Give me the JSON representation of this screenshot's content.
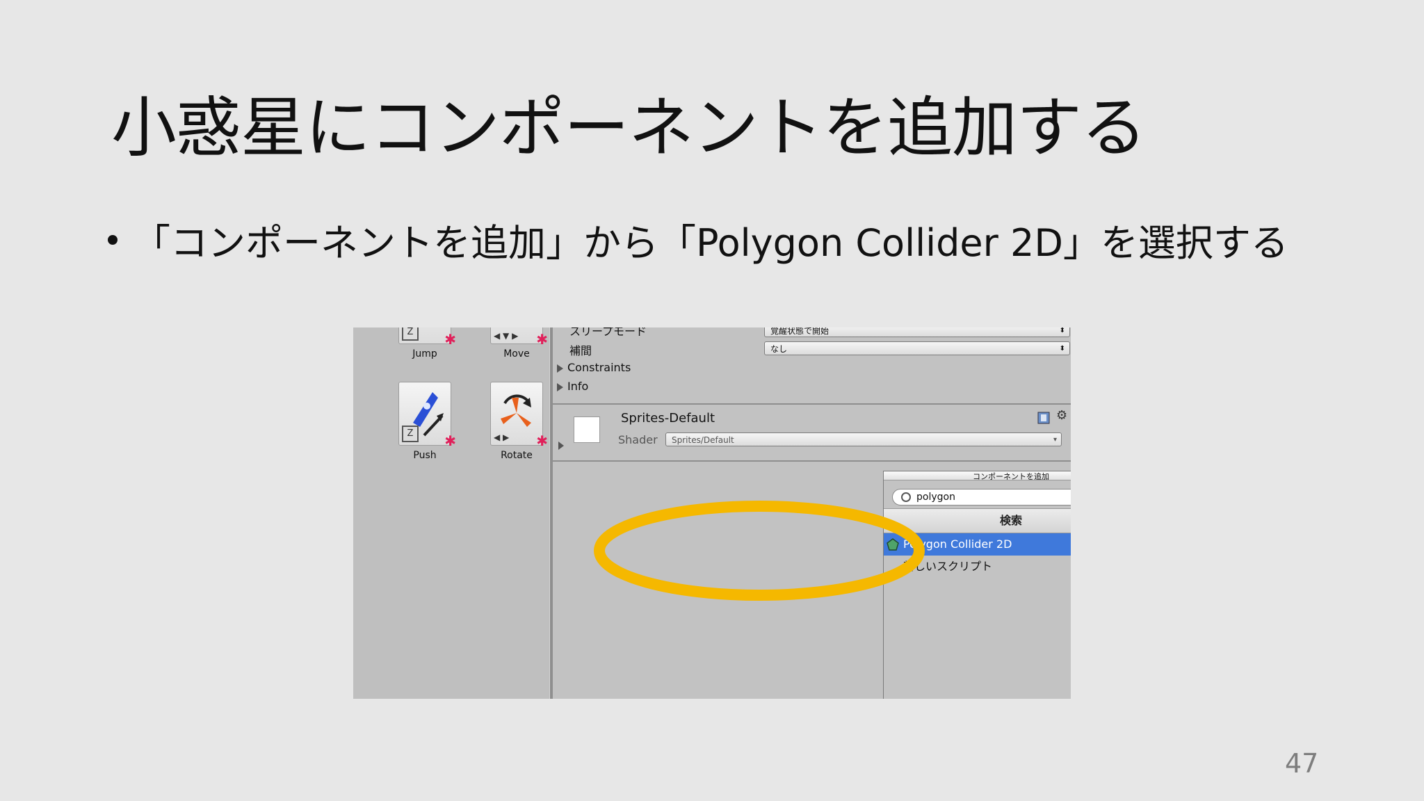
{
  "slide": {
    "title": "小惑星にコンポーネントを追加する",
    "bullet": "「コンポーネントを追加」から「Polygon Collider 2D」を選択する",
    "page_number": "47"
  },
  "project_panel": {
    "assets": [
      {
        "label": "Jump",
        "icon": "jump-behaviour-icon"
      },
      {
        "label": "Move",
        "icon": "move-behaviour-icon"
      },
      {
        "label": "Push",
        "icon": "rocket-push-icon"
      },
      {
        "label": "Rotate",
        "icon": "rotate-behaviour-icon"
      }
    ]
  },
  "inspector": {
    "sleep_mode": {
      "label": "スリープモード",
      "value": "覚醒状態で開始"
    },
    "interpolate": {
      "label": "補間",
      "value": "なし"
    },
    "constraints": "Constraints",
    "info": "Info",
    "material": {
      "name": "Sprites-Default",
      "shader_label": "Shader",
      "shader_value": "Sprites/Default"
    }
  },
  "add_component_popup": {
    "header": "コンポーネントを追加",
    "search_value": "polygon",
    "section_title": "検索",
    "results": [
      {
        "label": "Polygon Collider 2D",
        "selected": true
      },
      {
        "label": "新しいスクリプト",
        "selected": false
      }
    ]
  },
  "colors": {
    "highlight_ring": "#f5b800",
    "selection": "#3f79db"
  }
}
